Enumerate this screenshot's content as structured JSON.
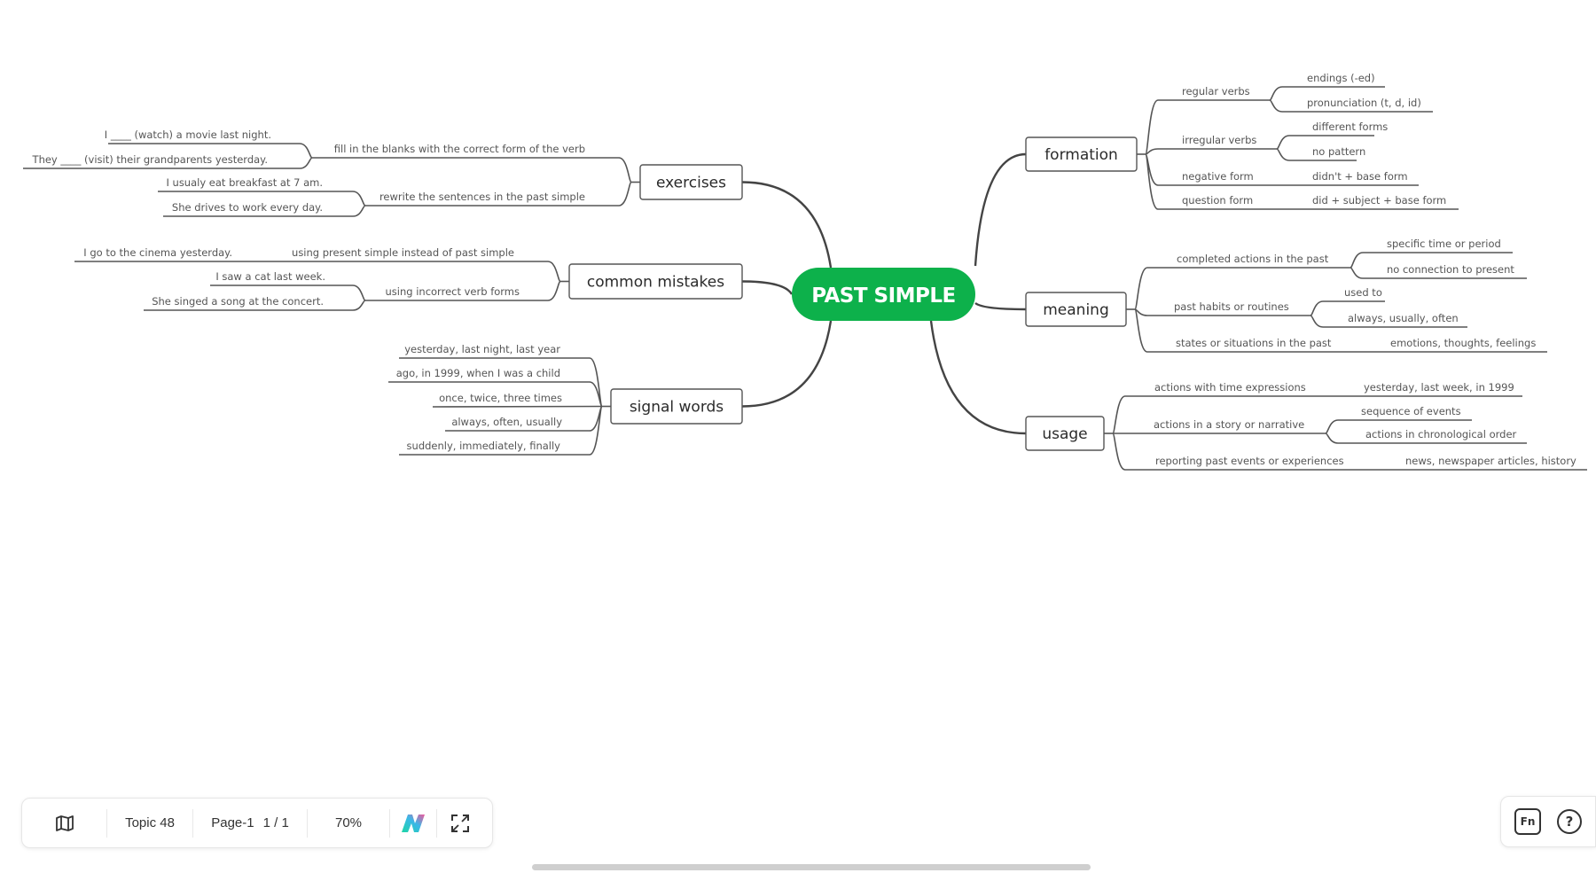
{
  "central": {
    "label": "PAST SIMPLE",
    "color": "#0db14b"
  },
  "right_topics": [
    {
      "label": "formation",
      "subtopics": [
        {
          "label": "regular verbs",
          "children": [
            "endings (-ed)",
            "pronunciation (t, d, id)"
          ]
        },
        {
          "label": "irregular verbs",
          "children": [
            "different forms",
            "no pattern"
          ]
        },
        {
          "label": "negative form",
          "children": [
            "didn't + base form"
          ]
        },
        {
          "label": "question form",
          "children": [
            "did + subject + base form"
          ]
        }
      ]
    },
    {
      "label": "meaning",
      "subtopics": [
        {
          "label": "completed actions in the past",
          "children": [
            "specific time or period",
            "no connection to present"
          ]
        },
        {
          "label": "past habits or routines",
          "children": [
            "used to",
            "always, usually, often"
          ]
        },
        {
          "label": "states or situations in the past",
          "children": [
            "emotions, thoughts, feelings"
          ]
        }
      ]
    },
    {
      "label": "usage",
      "subtopics": [
        {
          "label": "actions with time expressions",
          "children": [
            "yesterday, last week, in 1999"
          ]
        },
        {
          "label": "actions in a story or narrative",
          "children": [
            "sequence of events",
            "actions in chronological order"
          ]
        },
        {
          "label": "reporting past events or experiences",
          "children": [
            "news, newspaper articles, history"
          ]
        }
      ]
    }
  ],
  "left_topics": [
    {
      "label": "exercises",
      "subtopics": [
        {
          "label": "fill in the blanks with the correct form of the verb",
          "children": [
            "I ____ (watch) a movie last night.",
            "They ____ (visit) their grandparents yesterday."
          ]
        },
        {
          "label": "rewrite the sentences in the past simple",
          "children": [
            "I usualy eat breakfast at 7 am.",
            "She drives to work every day."
          ]
        }
      ]
    },
    {
      "label": "common mistakes",
      "subtopics": [
        {
          "label": "using present simple instead of past simple",
          "children": [
            "I go to the cinema yesterday."
          ]
        },
        {
          "label": "using incorrect verb forms",
          "children": [
            "I saw a cat last week.",
            "She singed a song at the concert."
          ]
        }
      ]
    },
    {
      "label": "signal words",
      "subtopics": [
        {
          "label": "yesterday, last night, last year",
          "children": []
        },
        {
          "label": "ago, in 1999, when I was a child",
          "children": []
        },
        {
          "label": "once, twice, three times",
          "children": []
        },
        {
          "label": "always, often, usually",
          "children": []
        },
        {
          "label": "suddenly, immediately, finally",
          "children": []
        }
      ]
    }
  ],
  "toolbar": {
    "map_icon": "map-icon",
    "topic_count": "Topic 48",
    "page_label": "Page-1",
    "page_count": "1 / 1",
    "zoom_level": "70%",
    "logo_icon": "app-logo-icon",
    "fullscreen_icon": "fullscreen-icon"
  },
  "right_tools": {
    "fn_icon": "function-key-icon",
    "fn_label": "Fn",
    "help_icon": "help-icon",
    "help_label": "?"
  }
}
